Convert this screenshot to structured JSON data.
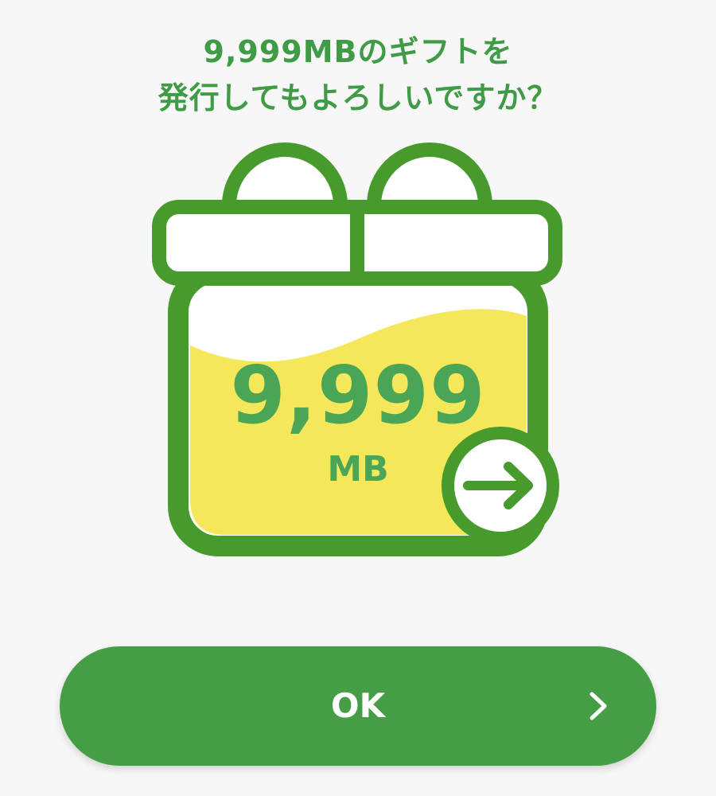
{
  "title": {
    "line1": "9,999MBのギフトを",
    "line2": "発行してもよろしいですか？"
  },
  "gift": {
    "amount": "9,999",
    "unit": "MB",
    "icon": "gift-box-icon",
    "send_icon": "arrow-right-circle-icon"
  },
  "ok_button": {
    "label": "OK",
    "icon": "chevron-right-icon"
  },
  "colors": {
    "primary_green": "#459e45",
    "text_green": "#3f9b45",
    "fill_yellow": "#f4e85a",
    "background": "#f7f7f7"
  }
}
